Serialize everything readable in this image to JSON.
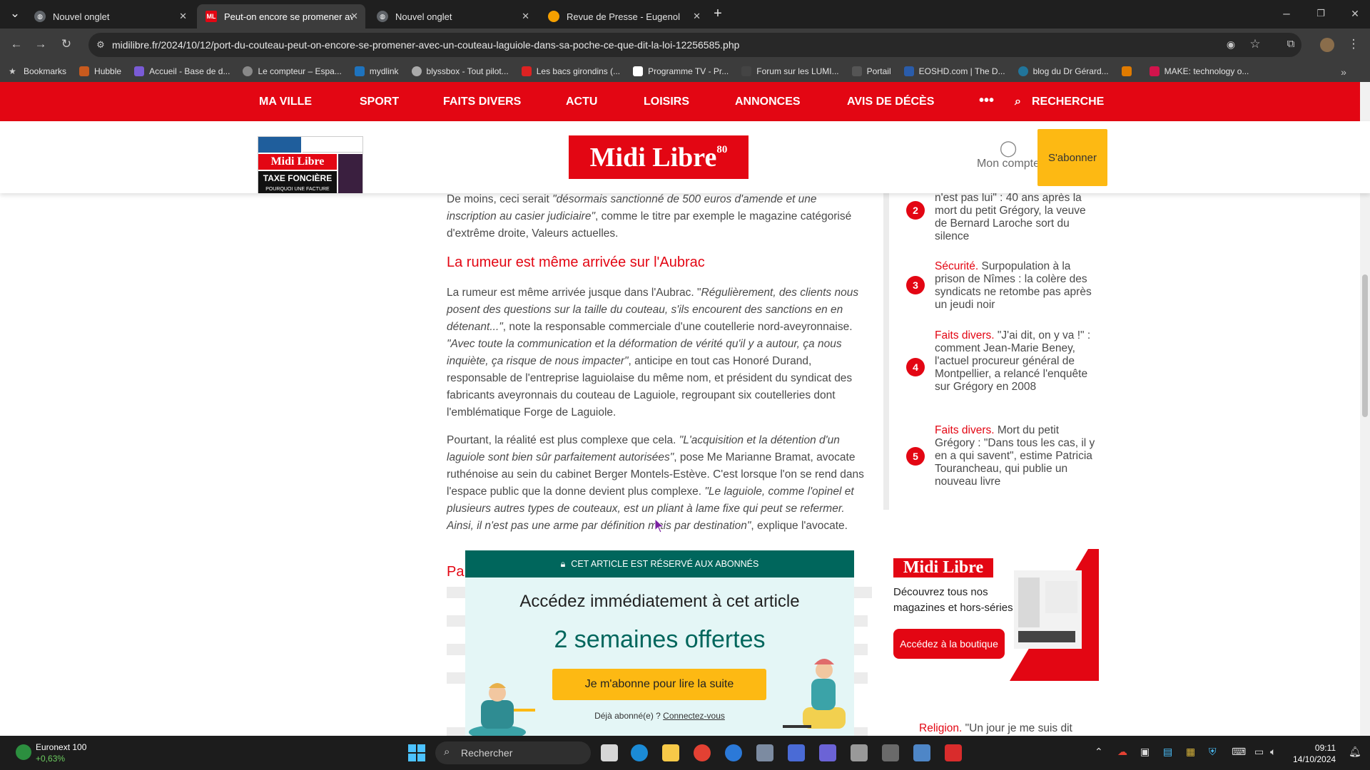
{
  "browser": {
    "tabs": [
      {
        "title": "Nouvel onglet",
        "active": false
      },
      {
        "title": "Peut-on encore se promener av",
        "active": true
      },
      {
        "title": "Nouvel onglet",
        "active": false
      },
      {
        "title": "Revue de Presse - Eugenol",
        "active": false
      }
    ],
    "url": "midilibre.fr/2024/10/12/port-du-couteau-peut-on-encore-se-promener-avec-un-couteau-laguiole-dans-sa-poche-ce-que-dit-la-loi-12256585.php",
    "bookmarks": [
      "Bookmarks",
      "Hubble",
      "Accueil - Base de d...",
      "Le compteur – Espa...",
      "mydlink",
      "blyssbox - Tout pilot...",
      "Les bacs girondins (...",
      "Programme TV - Pr...",
      "Forum sur les LUMI...",
      "Portail",
      "EOSHD.com | The D...",
      "blog du Dr Gérard...",
      "",
      "MAKE: technology o..."
    ]
  },
  "site": {
    "nav": [
      "MA VILLE",
      "SPORT",
      "FAITS DIVERS",
      "ACTU",
      "LOISIRS",
      "ANNONCES",
      "AVIS DE DÉCÈS",
      "•••",
      "RECHERCHE"
    ],
    "logo": "Midi Libre",
    "logo_badge": "80",
    "account": "Mon compte",
    "subscribe": "S'abonner",
    "magazine": {
      "headline": "TAXE FONCIÈRE",
      "sub": "POURQUOI UNE FACTURE",
      "title": "Midi Libre"
    }
  },
  "article": {
    "p1a": "De moins, ceci serait ",
    "p1b": "\"désormais sanctionné de 500 euros d'amende et une inscription au casier judiciaire\"",
    "p1c": ", comme le titre par exemple le magazine catégorisé d'extrême droite, Valeurs actuelles.",
    "h2": "La rumeur est même arrivée sur l'Aubrac",
    "p2a": "La rumeur est même arrivée jusque dans l'Aubrac. \"",
    "p2b": "Régulièrement, des clients nous posent des questions sur la taille du couteau, s'ils encourent des sanctions en en détenant...\"",
    "p2c": ", note la responsable commerciale d'une coutellerie nord-aveyronnaise. ",
    "p2d": "\"Avec toute la communication et la déformation de vérité qu'il y a autour, ça nous inquiète, ça risque de nous impacter\"",
    "p2e": ", anticipe en tout cas Honoré Durand, responsable de l'entreprise laguiolaise du même nom, et président du syndicat des fabricants aveyronnais du couteau de Laguiole, regroupant six coutelleries dont l'emblématique Forge de Laguiole.",
    "p3a": "Pourtant, la réalité est plus complexe que cela. ",
    "p3b": "\"L'acquisition et la détention d'un laguiole sont bien sûr parfaitement autorisées\"",
    "p3c": ", pose Me Marianne Bramat, avocate ruthénoise au sein du cabinet Berger Montels-Estève. C'est lorsque l'on se rend dans l'espace public que la donne devient plus complexe. ",
    "p3d": "\"Le laguiole, comme l'opinel et plusieurs autres types de couteaux, est un pliant à lame fixe qui peut se refermer. Ainsi, il n'est pas une arme par définition mais par destination\"",
    "p3e": ", explique l'avocate.",
    "h3_fragment": "Pa"
  },
  "sidebar": {
    "items": [
      {
        "rank": "2",
        "category": "",
        "text": "n'est pas lui\" : 40 ans après la mort du petit Grégory, la veuve de Bernard Laroche sort du silence"
      },
      {
        "rank": "3",
        "category": "Sécurité.",
        "text": " Surpopulation à la prison de Nîmes : la colère des syndicats ne retombe pas après un jeudi noir"
      },
      {
        "rank": "4",
        "category": "Faits divers.",
        "text": " \"J'ai dit, on y va !\" : comment Jean-Marie Beney, l'actuel procureur général de Montpellier, a relancé l'enquête sur Grégory en 2008"
      },
      {
        "rank": "5",
        "category": "Faits divers.",
        "text": " Mort du petit Grégory : \"Dans tous les cas, il y en a qui savent\", estime Patricia Tourancheau, qui publie un nouveau livre"
      }
    ],
    "ad": {
      "logo": "Midi Libre",
      "text": "Découvrez tous nos magazines et hors-séries",
      "button": "Accédez à la boutique"
    },
    "next_category": "Religion.",
    "next_text": " \"Un jour je me suis dit"
  },
  "paywall": {
    "bar": "CET ARTICLE EST RÉSERVÉ AUX ABONNÉS",
    "title": "Accédez immédiatement à cet article",
    "offer": "2 semaines offertes",
    "button": "Je m'abonne pour lire la suite",
    "login_prefix": "Déjà abonné(e) ? ",
    "login_link": "Connectez-vous"
  },
  "taskbar": {
    "stock_name": "Euronext 100",
    "stock_change": "+0,63%",
    "search": "Rechercher",
    "time": "09:11",
    "date": "14/10/2024"
  },
  "colors": {
    "brand": "#e30613",
    "paywall": "#00665c",
    "accent": "#fdb913"
  }
}
